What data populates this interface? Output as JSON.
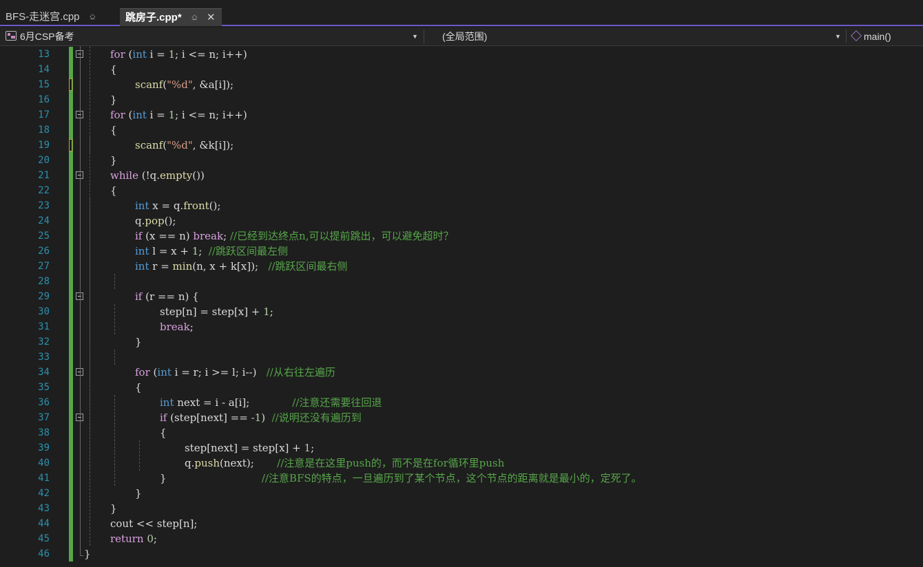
{
  "tabs": [
    {
      "label": "BFS-走迷宫.cpp",
      "pin": "⎐",
      "active": false
    },
    {
      "label": "跳房子.cpp*",
      "pin": "⎐",
      "close": "✕",
      "active": true
    }
  ],
  "navbar": {
    "project": "6月CSP备考",
    "scope": "(全局范围)",
    "member": "main()"
  },
  "editor": {
    "lines": [
      {
        "n": "13",
        "indent": 1,
        "fold": true,
        "tokens": [
          [
            "ctl",
            "for"
          ],
          [
            "p",
            " ("
          ],
          [
            "kw",
            "int"
          ],
          [
            "p",
            " i = "
          ],
          [
            "num",
            "1"
          ],
          [
            "p",
            "; i <= n; i++)"
          ]
        ]
      },
      {
        "n": "14",
        "indent": 1,
        "tokens": [
          [
            "p",
            "{"
          ]
        ]
      },
      {
        "n": "15",
        "indent": 2,
        "marker": true,
        "tokens": [
          [
            "fn",
            "scanf"
          ],
          [
            "p",
            "("
          ],
          [
            "str",
            "\"%d\""
          ],
          [
            "p",
            ", &a[i]);"
          ]
        ]
      },
      {
        "n": "16",
        "indent": 1,
        "tokens": [
          [
            "p",
            "}"
          ]
        ]
      },
      {
        "n": "17",
        "indent": 1,
        "fold": true,
        "tokens": [
          [
            "ctl",
            "for"
          ],
          [
            "p",
            " ("
          ],
          [
            "kw",
            "int"
          ],
          [
            "p",
            " i = "
          ],
          [
            "num",
            "1"
          ],
          [
            "p",
            "; i <= n; i++)"
          ]
        ]
      },
      {
        "n": "18",
        "indent": 1,
        "tokens": [
          [
            "p",
            "{"
          ]
        ]
      },
      {
        "n": "19",
        "indent": 2,
        "marker": true,
        "tokens": [
          [
            "fn",
            "scanf"
          ],
          [
            "p",
            "("
          ],
          [
            "str",
            "\"%d\""
          ],
          [
            "p",
            ", &k[i]);"
          ]
        ]
      },
      {
        "n": "20",
        "indent": 1,
        "tokens": [
          [
            "p",
            "}"
          ]
        ]
      },
      {
        "n": "21",
        "indent": 1,
        "fold": true,
        "tokens": [
          [
            "ctl",
            "while"
          ],
          [
            "p",
            " (!q."
          ],
          [
            "fn",
            "empty"
          ],
          [
            "p",
            "())"
          ]
        ]
      },
      {
        "n": "22",
        "indent": 1,
        "tokens": [
          [
            "p",
            "{"
          ]
        ]
      },
      {
        "n": "23",
        "indent": 2,
        "tokens": [
          [
            "kw",
            "int"
          ],
          [
            "p",
            " x = q."
          ],
          [
            "fn",
            "front"
          ],
          [
            "p",
            "();"
          ]
        ]
      },
      {
        "n": "24",
        "indent": 2,
        "tokens": [
          [
            "p",
            "q."
          ],
          [
            "fn",
            "pop"
          ],
          [
            "p",
            "();"
          ]
        ]
      },
      {
        "n": "25",
        "indent": 2,
        "tokens": [
          [
            "ctl",
            "if"
          ],
          [
            "p",
            " (x == n) "
          ],
          [
            "ctl",
            "break"
          ],
          [
            "p",
            "; "
          ],
          [
            "cmt",
            "//已经到达终点n,可以提前跳出，可以避免超时？"
          ]
        ]
      },
      {
        "n": "26",
        "indent": 2,
        "tokens": [
          [
            "kw",
            "int"
          ],
          [
            "p",
            " l = x + "
          ],
          [
            "num",
            "1"
          ],
          [
            "p",
            ";  "
          ],
          [
            "cmt",
            "//跳跃区间最左侧"
          ]
        ]
      },
      {
        "n": "27",
        "indent": 2,
        "tokens": [
          [
            "kw",
            "int"
          ],
          [
            "p",
            " r = "
          ],
          [
            "fn",
            "min"
          ],
          [
            "p",
            "(n, x + k[x]);   "
          ],
          [
            "cmt",
            "//跳跃区间最右侧"
          ]
        ]
      },
      {
        "n": "28",
        "indent": 2,
        "tokens": []
      },
      {
        "n": "29",
        "indent": 2,
        "fold": true,
        "tokens": [
          [
            "ctl",
            "if"
          ],
          [
            "p",
            " (r == n) {"
          ]
        ]
      },
      {
        "n": "30",
        "indent": 3,
        "tokens": [
          [
            "p",
            "step[n] = step[x] + "
          ],
          [
            "num",
            "1"
          ],
          [
            "p",
            ";"
          ]
        ]
      },
      {
        "n": "31",
        "indent": 3,
        "tokens": [
          [
            "ctl",
            "break"
          ],
          [
            "p",
            ";"
          ]
        ]
      },
      {
        "n": "32",
        "indent": 2,
        "tokens": [
          [
            "p",
            "}"
          ]
        ]
      },
      {
        "n": "33",
        "indent": 2,
        "tokens": []
      },
      {
        "n": "34",
        "indent": 2,
        "fold": true,
        "tokens": [
          [
            "ctl",
            "for"
          ],
          [
            "p",
            " ("
          ],
          [
            "kw",
            "int"
          ],
          [
            "p",
            " i = r; i >= l; i--)   "
          ],
          [
            "cmt",
            "//从右往左遍历"
          ]
        ]
      },
      {
        "n": "35",
        "indent": 2,
        "tokens": [
          [
            "p",
            "{"
          ]
        ]
      },
      {
        "n": "36",
        "indent": 3,
        "tokens": [
          [
            "kw",
            "int"
          ],
          [
            "p",
            " next = i - a[i];             "
          ],
          [
            "cmt",
            "//注意还需要往回退"
          ]
        ]
      },
      {
        "n": "37",
        "indent": 3,
        "fold": true,
        "tokens": [
          [
            "ctl",
            "if"
          ],
          [
            "p",
            " (step[next] == "
          ],
          [
            "num",
            "-1"
          ],
          [
            "p",
            ")  "
          ],
          [
            "cmt",
            "//说明还没有遍历到"
          ]
        ]
      },
      {
        "n": "38",
        "indent": 3,
        "tokens": [
          [
            "p",
            "{"
          ]
        ]
      },
      {
        "n": "39",
        "indent": 4,
        "tokens": [
          [
            "p",
            "step[next] = step[x] + "
          ],
          [
            "num",
            "1"
          ],
          [
            "p",
            ";"
          ]
        ]
      },
      {
        "n": "40",
        "indent": 4,
        "tokens": [
          [
            "p",
            "q."
          ],
          [
            "fn",
            "push"
          ],
          [
            "p",
            "(next);       "
          ],
          [
            "cmt",
            "//注意是在这里push的，而不是在for循环里push"
          ]
        ]
      },
      {
        "n": "41",
        "indent": 3,
        "tokens": [
          [
            "p",
            "}                             "
          ],
          [
            "cmt",
            "//注意BFS的特点，一旦遍历到了某个节点，这个节点的距离就是最小的，定死了。"
          ]
        ]
      },
      {
        "n": "42",
        "indent": 2,
        "tokens": [
          [
            "p",
            "}"
          ]
        ]
      },
      {
        "n": "43",
        "indent": 1,
        "tokens": [
          [
            "p",
            "}"
          ]
        ]
      },
      {
        "n": "44",
        "indent": 1,
        "tokens": [
          [
            "p",
            "cout << step[n];"
          ]
        ]
      },
      {
        "n": "45",
        "indent": 1,
        "tokens": [
          [
            "ctl",
            "return"
          ],
          [
            "p",
            " "
          ],
          [
            "num",
            "0"
          ],
          [
            "p",
            ";"
          ]
        ]
      },
      {
        "n": "46",
        "indent": 0,
        "tokens": [
          [
            "p",
            "}"
          ]
        ]
      }
    ]
  },
  "colors": {
    "background": "#1e1e1e",
    "line_number": "#2b91af",
    "keyword_type": "#569cd6",
    "keyword_control": "#d8a0df",
    "function": "#dcdcaa",
    "string": "#d69d85",
    "number": "#b5cea8",
    "comment": "#57a64a",
    "change_bar": "#57a64a",
    "tab_accent": "#6e59c9"
  },
  "icons": {
    "project": "project-icon",
    "member": "cube-icon",
    "fold": "collapse-box-icon"
  }
}
